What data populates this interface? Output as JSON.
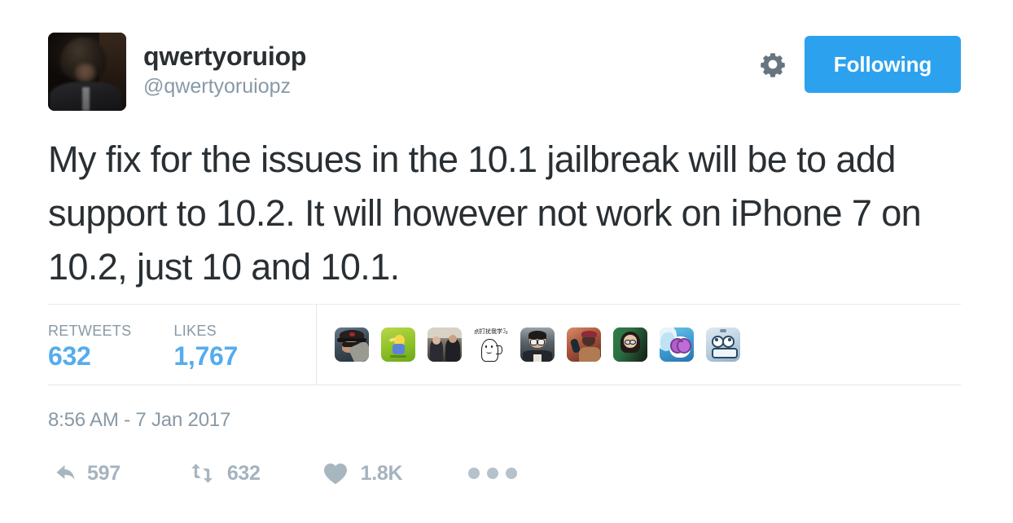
{
  "user": {
    "display_name": "qwertyoruiop",
    "handle": "@qwertyoruiopz",
    "avatar_alt": "profile-photo"
  },
  "header": {
    "gear_icon": "gear-icon",
    "follow_button_label": "Following",
    "follow_button_color": "#2CA2EE"
  },
  "tweet": {
    "text": "My fix for the issues in the 10.1 jailbreak will be to add support to 10.2. It will however not work on iPhone 7 on 10.2, just 10 and 10.1.",
    "timestamp": "8:56 AM - 7 Jan 2017",
    "text_color": "#292F33"
  },
  "stats": {
    "retweets_label": "RETWEETS",
    "retweets_value": "632",
    "likes_label": "LIKES",
    "likes_value": "1,767",
    "value_color": "#55ACEE",
    "label_color": "#8899A6"
  },
  "engagers": [
    {
      "name": "engager-avatar-1",
      "alt": "person-with-cap-and-sunglasses"
    },
    {
      "name": "engager-avatar-2",
      "alt": "yellow-cartoon-on-green"
    },
    {
      "name": "engager-avatar-3",
      "alt": "two-people-photo"
    },
    {
      "name": "engager-avatar-4",
      "alt": "white-cartoon-blob",
      "caption": "别打扰我学习"
    },
    {
      "name": "engager-avatar-5",
      "alt": "young-man-with-glasses"
    },
    {
      "name": "engager-avatar-6",
      "alt": "person-holding-phone"
    },
    {
      "name": "engager-avatar-7",
      "alt": "girl-with-glasses-green-background"
    },
    {
      "name": "engager-avatar-8",
      "alt": "pony-with-purple-sunglasses"
    },
    {
      "name": "engager-avatar-9",
      "alt": "blue-white-cartoon-face"
    }
  ],
  "actions": {
    "reply_icon": "reply-arrow-icon",
    "reply_count": "597",
    "retweet_icon": "retweet-icon",
    "retweet_count": "632",
    "like_icon": "heart-icon",
    "like_count": "1.8K",
    "more_icon": "more-ellipsis-icon",
    "icon_color": "#A8B6C0"
  }
}
